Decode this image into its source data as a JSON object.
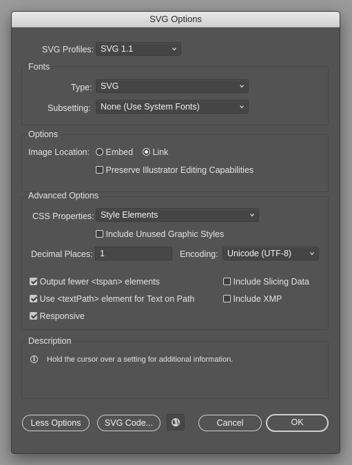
{
  "window": {
    "title": "SVG Options"
  },
  "profile": {
    "label": "SVG Profiles:",
    "value": "SVG 1.1"
  },
  "fonts": {
    "group_title": "Fonts",
    "type_label": "Type:",
    "type_value": "SVG",
    "subsetting_label": "Subsetting:",
    "subsetting_value": "None (Use System Fonts)"
  },
  "options": {
    "group_title": "Options",
    "image_location_label": "Image Location:",
    "embed_label": "Embed",
    "link_label": "Link",
    "image_location_selected": "Link",
    "preserve_label": "Preserve Illustrator Editing Capabilities",
    "preserve_checked": false
  },
  "advanced": {
    "group_title": "Advanced Options",
    "css_label": "CSS Properties:",
    "css_value": "Style Elements",
    "unused_styles_label": "Include Unused Graphic Styles",
    "unused_styles_checked": false,
    "decimal_label": "Decimal Places:",
    "decimal_value": "1",
    "encoding_label": "Encoding:",
    "encoding_value": "Unicode (UTF-8)",
    "fewer_tspan_label": "Output fewer <tspan> elements",
    "fewer_tspan_checked": true,
    "textpath_label": "Use <textPath> element for Text on Path",
    "textpath_checked": true,
    "responsive_label": "Responsive",
    "responsive_checked": true,
    "slicing_label": "Include Slicing Data",
    "slicing_checked": false,
    "xmp_label": "Include XMP",
    "xmp_checked": false
  },
  "description": {
    "group_title": "Description",
    "text": "Hold the cursor over a setting for additional information."
  },
  "buttons": {
    "less_options": "Less Options",
    "svg_code": "SVG Code...",
    "cancel": "Cancel",
    "ok": "OK"
  },
  "icons": {
    "chevron": "chevron-down-icon",
    "info": "info-icon",
    "web": "globe-icon"
  },
  "colors": {
    "dialog_bg": "#535353",
    "titlebar_bg": "#d8d8d8",
    "field_bg": "#454545",
    "text": "#e3e3e3"
  }
}
